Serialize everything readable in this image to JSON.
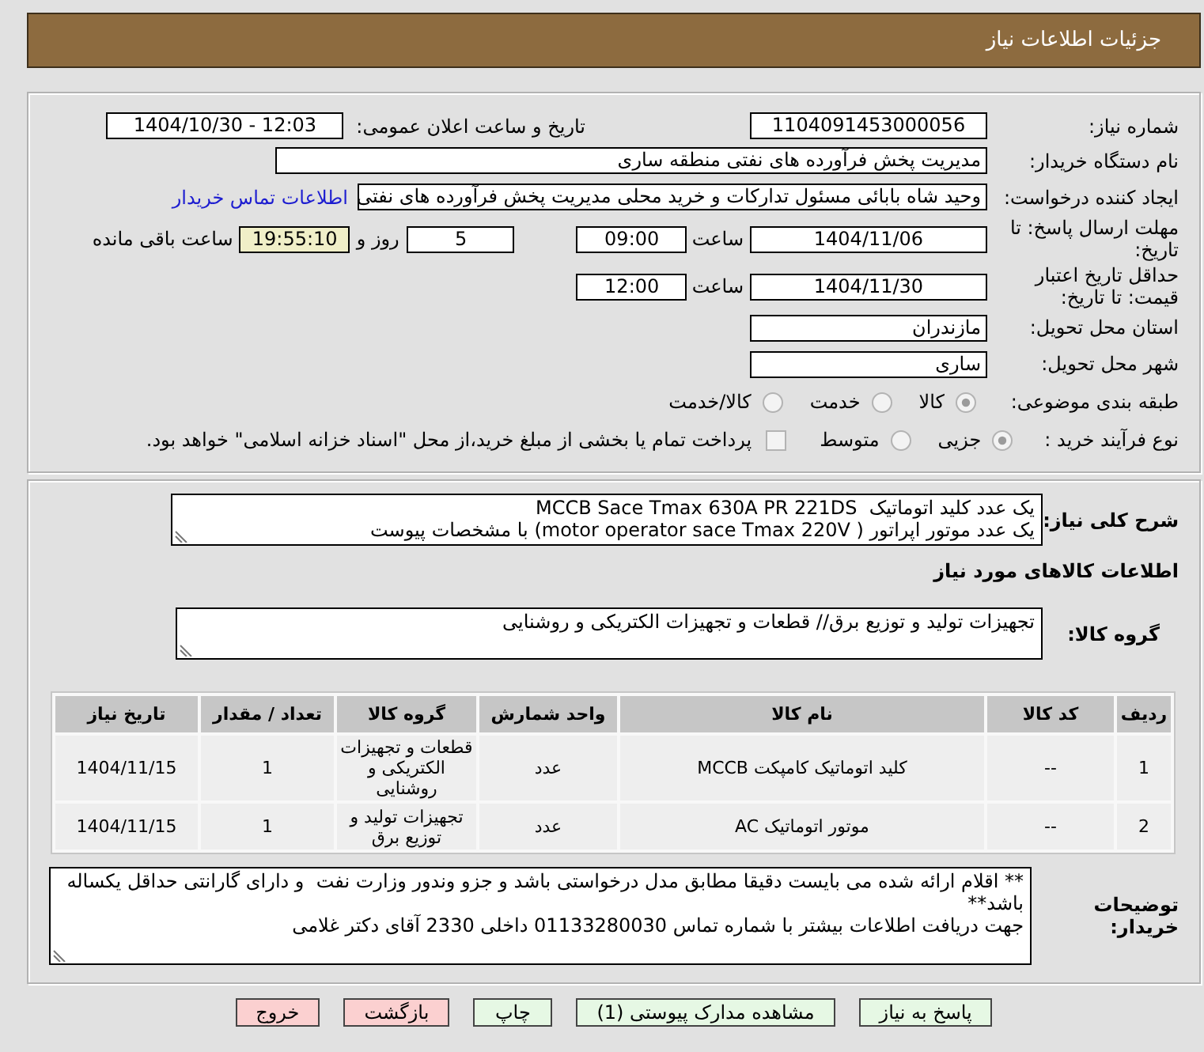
{
  "header": {
    "title": "جزئیات اطلاعات نیاز"
  },
  "details": {
    "need_number": {
      "label": "شماره نیاز:",
      "value": "1104091453000056"
    },
    "announce": {
      "label": "تاریخ و ساعت اعلان عمومی:",
      "value": "1404/10/30 - 12:03"
    },
    "buyer_org": {
      "label": "نام دستگاه خریدار:",
      "value": "مدیریت پخش فرآورده های نفتی منطقه ساری"
    },
    "requester": {
      "label": "ایجاد کننده درخواست:",
      "value": "وحید شاه بابائی مسئول تدارکات و خرید محلی مدیریت پخش فرآورده های نفتی",
      "contact_link": "اطلاعات تماس خریدار"
    },
    "reply_deadline": {
      "label": "مهلت ارسال پاسخ: تا تاریخ:",
      "date": "1404/11/06",
      "time_label": "ساعت",
      "time": "09:00",
      "days": "5",
      "days_label": "روز و",
      "remaining": "19:55:10",
      "remaining_label": "ساعت باقی مانده"
    },
    "price_validity": {
      "label": "حداقل تاریخ اعتبار قیمت: تا تاریخ:",
      "date": "1404/11/30",
      "time_label": "ساعت",
      "time": "12:00"
    },
    "province": {
      "label": "استان محل تحویل:",
      "value": "مازندران"
    },
    "city": {
      "label": "شهر محل تحویل:",
      "value": "ساری"
    },
    "category": {
      "label": "طبقه بندی موضوعی:",
      "options": [
        {
          "label": "کالا",
          "selected": true
        },
        {
          "label": "خدمت",
          "selected": false
        },
        {
          "label": "کالا/خدمت",
          "selected": false
        }
      ]
    },
    "purchase_type": {
      "label": "نوع فرآیند خرید :",
      "options": [
        {
          "label": "جزیی",
          "selected": true
        },
        {
          "label": "متوسط",
          "selected": false
        }
      ],
      "treasury": {
        "label": "پرداخت تمام یا بخشی از مبلغ خرید،از محل \"اسناد خزانه اسلامی\" خواهد بود.",
        "checked": false
      }
    }
  },
  "need": {
    "description": {
      "label": "شرح کلی نیاز:",
      "value": "یک عدد کلید اتوماتیک  MCCB Sace Tmax 630A PR 221DS\nیک عدد موتور اپراتور ( motor operator sace Tmax 220V) با مشخصات پیوست"
    },
    "goods_heading": "اطلاعات کالاهای مورد نیاز",
    "goods_group": {
      "label": "گروه کالا:",
      "value": "تجهیزات تولید و توزیع برق// قطعات و تجهیزات الکتریکی و روشنایی"
    },
    "table": {
      "columns": [
        "ردیف",
        "کد کالا",
        "نام کالا",
        "واحد شمارش",
        "گروه کالا",
        "تعداد / مقدار",
        "تاریخ نیاز"
      ],
      "rows": [
        [
          "1",
          "--",
          "کلید اتوماتیک کامپکت MCCB",
          "عدد",
          "قطعات و تجهیزات الکتریکی و روشنایی",
          "1",
          "1404/11/15"
        ],
        [
          "2",
          "--",
          "موتور اتوماتیک AC",
          "عدد",
          "تجهیزات تولید و توزیع برق",
          "1",
          "1404/11/15"
        ]
      ]
    },
    "notes": {
      "label": "توضیحات خریدار:",
      "value": "** اقلام ارائه شده می بایست دقیقا مطابق مدل درخواستی باشد و جزو وندور وزارت نفت  و دارای گارانتی حداقل یکساله باشد**\nجهت دریافت اطلاعات بیشتر با شماره تماس 01133280030 داخلی 2330 آقای دکتر غلامی"
    }
  },
  "buttons": [
    {
      "label": "پاسخ به نیاز",
      "kind": "positive"
    },
    {
      "label": "مشاهده مدارک پیوستی (1)",
      "kind": "positive"
    },
    {
      "label": "چاپ",
      "kind": "positive"
    },
    {
      "label": "بازگشت",
      "kind": "negative"
    },
    {
      "label": "خروج",
      "kind": "negative"
    }
  ]
}
